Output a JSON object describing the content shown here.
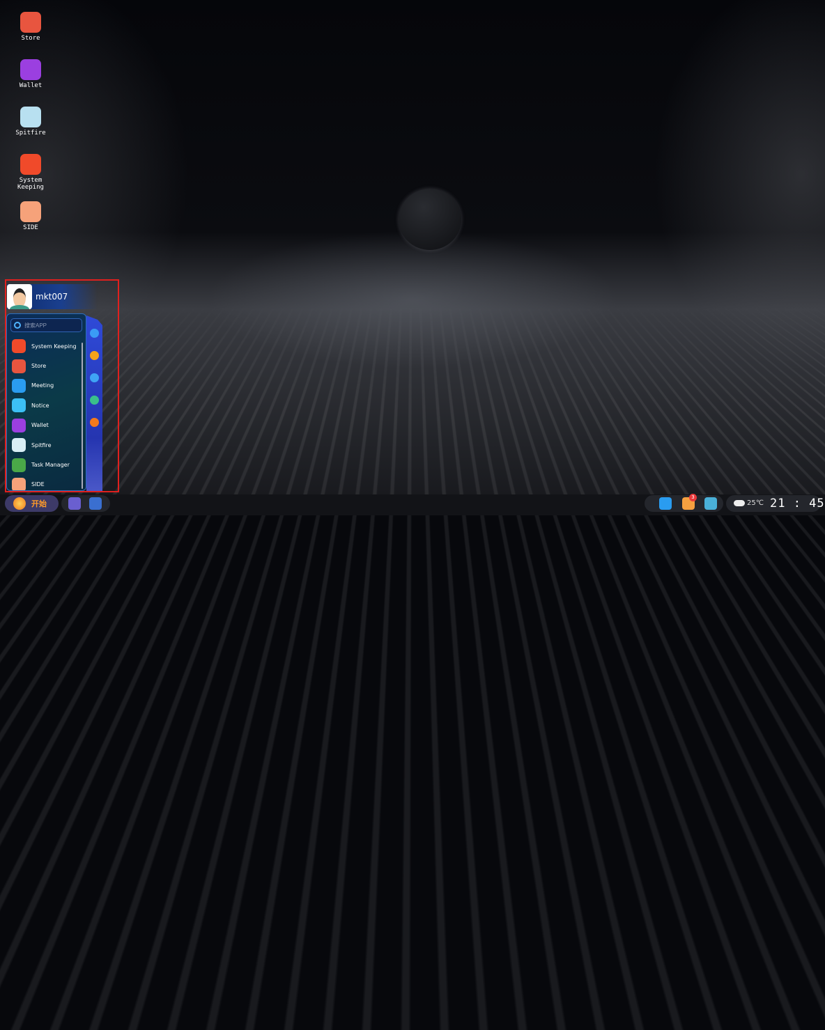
{
  "desktop_icons": [
    {
      "label": "Store",
      "icon": "store-bag-icon",
      "color": "#e8553f"
    },
    {
      "label": "Wallet",
      "icon": "wallet-icon",
      "color": "#9b3fe0"
    },
    {
      "label": "Spitfire",
      "icon": "spitfire-icon",
      "color": "#b8e0f0"
    },
    {
      "label": "System Keeping",
      "icon": "gear-icon",
      "color": "#f04a2a"
    },
    {
      "label": "SIDE",
      "icon": "side-icon",
      "color": "#f6a27a"
    }
  ],
  "start_menu": {
    "username": "mkt007",
    "search_placeholder": "搜索APP",
    "items": [
      {
        "label": "System Keeping",
        "icon": "gear-icon",
        "color": "#f04a2a"
      },
      {
        "label": "Store",
        "icon": "store-bag-icon",
        "color": "#e8553f"
      },
      {
        "label": "Meeting",
        "icon": "meeting-icon",
        "color": "#2a9cf0"
      },
      {
        "label": "Notice",
        "icon": "bell-icon",
        "color": "#3cc0f5"
      },
      {
        "label": "Wallet",
        "icon": "wallet-icon",
        "color": "#9b3fe0"
      },
      {
        "label": "Spitfire",
        "icon": "spitfire-icon",
        "color": "#d8eef5"
      },
      {
        "label": "Task Manager",
        "icon": "task-manager-icon",
        "color": "#4aa848"
      },
      {
        "label": "SIDE",
        "icon": "side-icon",
        "color": "#f6a27a"
      }
    ],
    "side_buttons": [
      {
        "icon": "settings-icon",
        "color": "#3a9cf5"
      },
      {
        "icon": "help-icon",
        "color": "#f5a31a"
      },
      {
        "icon": "window-icon",
        "color": "#3fa4f5"
      },
      {
        "icon": "home-icon",
        "color": "#3ac08a"
      },
      {
        "icon": "power-icon",
        "color": "#f57a1a"
      }
    ]
  },
  "taskbar": {
    "start_label": "开始",
    "pinned": [
      {
        "icon": "monitor-icon",
        "color": "#6a5fd0"
      },
      {
        "icon": "server-icon",
        "color": "#3a6fd0"
      }
    ],
    "tray": [
      {
        "icon": "meeting-icon",
        "color": "#2a9cf0"
      },
      {
        "icon": "mail-icon",
        "color": "#f5a040",
        "badge": "3"
      },
      {
        "icon": "scissors-icon",
        "color": "#4ab0d8"
      }
    ],
    "temperature": "25℃",
    "weather_icon": "cloud-icon",
    "time": "21 : 45"
  }
}
